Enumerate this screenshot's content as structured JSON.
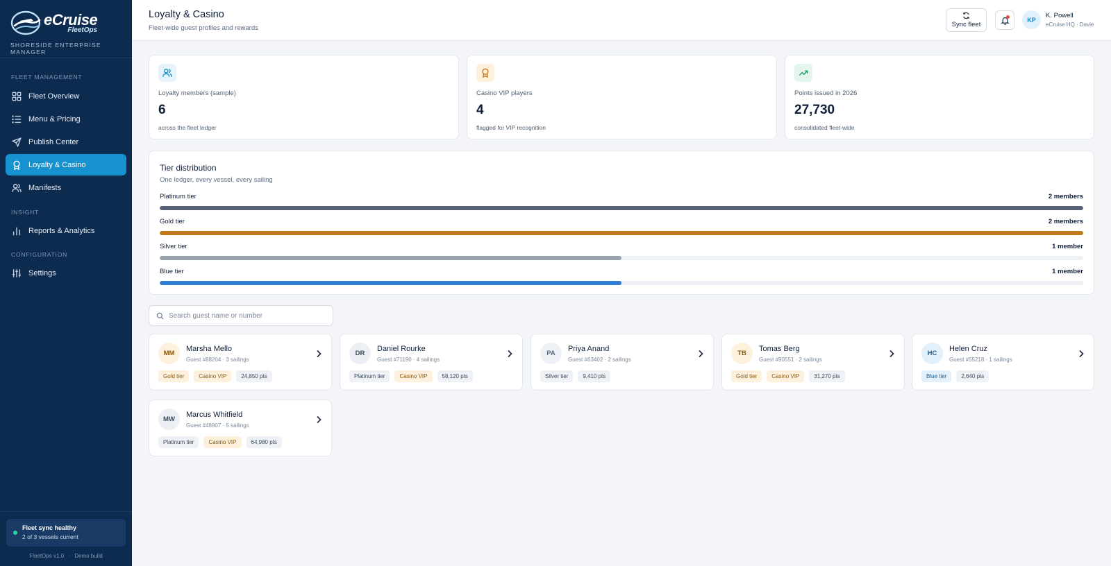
{
  "brand": {
    "name": "eCruise",
    "product": "FleetOps",
    "tagline": "SHORESIDE ENTERPRISE MANAGER"
  },
  "nav": {
    "sections": [
      {
        "label": "FLEET MANAGEMENT"
      },
      {
        "label": "INSIGHT"
      },
      {
        "label": "CONFIGURATION"
      }
    ],
    "items": [
      {
        "label": "Fleet Overview",
        "icon": "grid-icon"
      },
      {
        "label": "Menu & Pricing",
        "icon": "list-icon"
      },
      {
        "label": "Publish Center",
        "icon": "send-icon"
      },
      {
        "label": "Loyalty & Casino",
        "icon": "award-icon",
        "active": true
      },
      {
        "label": "Manifests",
        "icon": "users-icon"
      },
      {
        "label": "Reports & Analytics",
        "icon": "bar-chart-icon"
      },
      {
        "label": "Settings",
        "icon": "sliders-icon"
      }
    ]
  },
  "sync_status": {
    "title": "Fleet sync healthy",
    "detail": "2 of 3 vessels current",
    "color": "#2ed39a"
  },
  "version": {
    "app": "FleetOps v1.0",
    "separator": "·",
    "build": "Demo build"
  },
  "header": {
    "title": "Loyalty & Casino",
    "subtitle": "Fleet-wide guest profiles and rewards",
    "sync_label": "Sync fleet",
    "user": {
      "initials": "KP",
      "name": "K. Powell",
      "org": "eCruise HQ · Davie"
    }
  },
  "stats": [
    {
      "label": "Loyalty members (sample)",
      "value": "6",
      "sub": "across the fleet ledger",
      "icon": "users-icon",
      "color": "#1592cf"
    },
    {
      "label": "Casino VIP players",
      "value": "4",
      "sub": "flagged for VIP recognition",
      "icon": "award-icon",
      "color": "#c17a1a"
    },
    {
      "label": "Points issued in 2026",
      "value": "27,730",
      "sub": "consolidated fleet-wide",
      "icon": "trending-up-icon",
      "color": "#1e9e6a"
    }
  ],
  "tiers": {
    "title": "Tier distribution",
    "subtitle": "One ledger, every vessel, every sailing",
    "rows": [
      {
        "name": "Platinum tier",
        "count": "2 members",
        "fraction": 1.0,
        "color": "#5a6278"
      },
      {
        "name": "Gold tier",
        "count": "2 members",
        "fraction": 1.0,
        "color": "#c17a1a"
      },
      {
        "name": "Silver tier",
        "count": "1 member",
        "fraction": 0.5,
        "color": "#9aa2ae"
      },
      {
        "name": "Blue tier",
        "count": "1 member",
        "fraction": 0.5,
        "color": "#2f7fd0"
      }
    ]
  },
  "search": {
    "placeholder": "Search guest name or number",
    "value": ""
  },
  "guests": [
    {
      "initials": "MM",
      "name": "Marsha Mello",
      "meta": "Guest #88204 · 3 sailings",
      "tier": "gold",
      "tags": [
        "Gold tier",
        "Casino VIP",
        "24,850 pts"
      ]
    },
    {
      "initials": "DR",
      "name": "Daniel Rourke",
      "meta": "Guest #71190 · 4 sailings",
      "tier": "platinum",
      "tags": [
        "Platinum tier",
        "Casino VIP",
        "58,120 pts"
      ]
    },
    {
      "initials": "PA",
      "name": "Priya Anand",
      "meta": "Guest #63402 · 2 sailings",
      "tier": "silver",
      "tags": [
        "Silver tier",
        "9,410 pts"
      ]
    },
    {
      "initials": "TB",
      "name": "Tomas Berg",
      "meta": "Guest #90551 · 2 sailings",
      "tier": "gold",
      "tags": [
        "Gold tier",
        "Casino VIP",
        "31,270 pts"
      ]
    },
    {
      "initials": "HC",
      "name": "Helen Cruz",
      "meta": "Guest #55218 · 1 sailings",
      "tier": "blue",
      "tags": [
        "Blue tier",
        "2,640 pts"
      ]
    },
    {
      "initials": "MW",
      "name": "Marcus Whitfield",
      "meta": "Guest #48907 · 5 sailings",
      "tier": "platinum",
      "tags": [
        "Platinum tier",
        "Casino VIP",
        "64,980 pts"
      ]
    }
  ]
}
